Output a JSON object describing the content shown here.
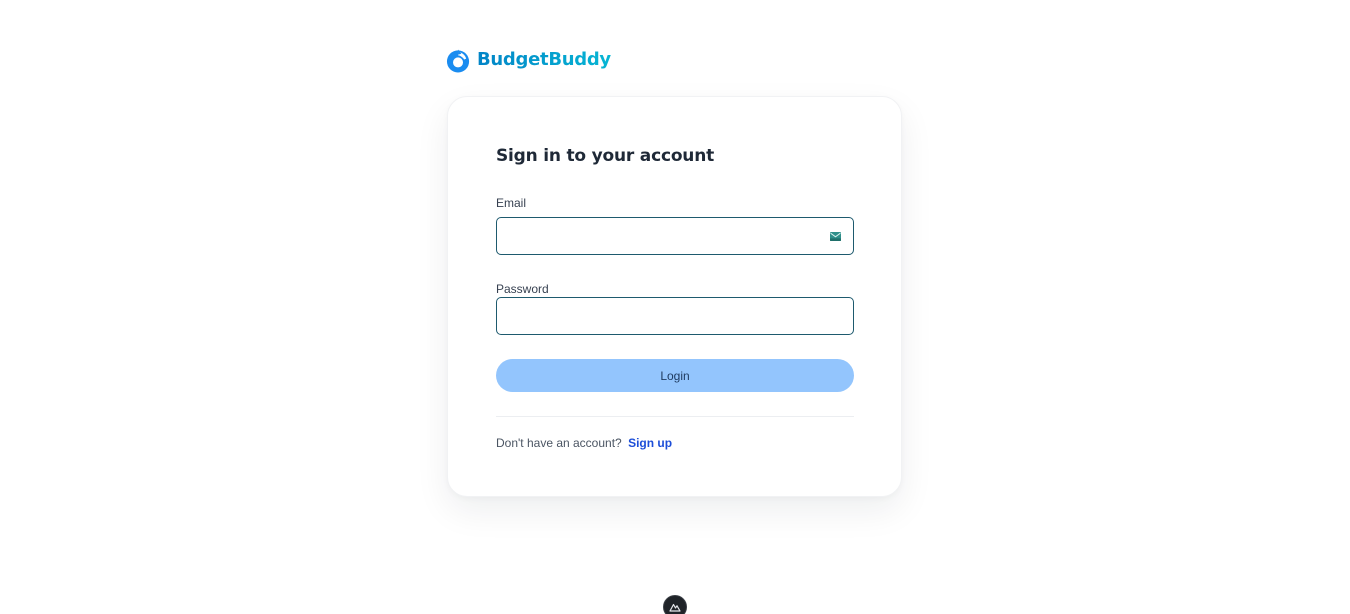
{
  "brand": {
    "name": "BudgetBuddy",
    "logo_icon": "droplet-logo-icon",
    "colors": {
      "from": "#0284c7",
      "to": "#06b6d4"
    }
  },
  "login_form": {
    "title": "Sign in to your account",
    "email": {
      "label": "Email",
      "value": "",
      "placeholder": "",
      "icon": "mail-icon"
    },
    "password": {
      "label": "Password",
      "value": "",
      "placeholder": ""
    },
    "submit_label": "Login",
    "footer": {
      "prompt": "Don't have an account?",
      "link_label": "Sign up"
    }
  },
  "devtools": {
    "icon": "nuxt-devtools-icon"
  },
  "colors": {
    "accent": "#0284c7",
    "button_bg": "#93c5fd",
    "input_border": "#1e5a6e",
    "link": "#1d4ed8"
  }
}
